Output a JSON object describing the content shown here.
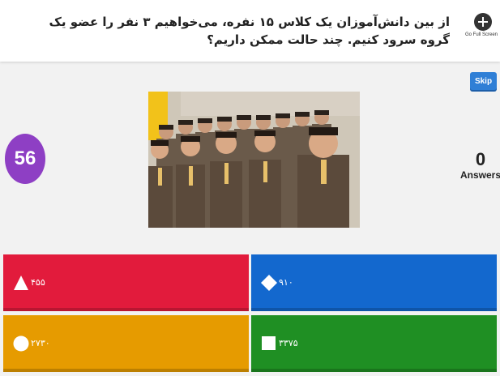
{
  "question": {
    "text": "از بین دانش‌آموزان یک کلاس ۱۵ نفره، می‌خواهیم ۳ نفر را عضو یک گروه سرود کنیم. چند حالت ممکن داریم؟"
  },
  "fullscreen": {
    "label": "Go Full Screen",
    "icon": "plus-circle-icon"
  },
  "skip_button": {
    "label": "Skip",
    "color": "#2f7fd6"
  },
  "timer": {
    "value": "56",
    "color": "#8e3fc4"
  },
  "answers_counter": {
    "count": "0",
    "label": "Answers"
  },
  "image": {
    "subject": "group of schoolboys in brown uniforms singing"
  },
  "options": [
    {
      "shape": "triangle-icon",
      "text": "۴۵۵",
      "color": "#e21b3c"
    },
    {
      "shape": "diamond-icon",
      "text": "۹۱۰",
      "color": "#1368ce"
    },
    {
      "shape": "circle-icon",
      "text": "۲۷۳۰",
      "color": "#e69b00"
    },
    {
      "shape": "square-icon",
      "text": "۳۳۷۵",
      "color": "#1f8f23"
    }
  ]
}
